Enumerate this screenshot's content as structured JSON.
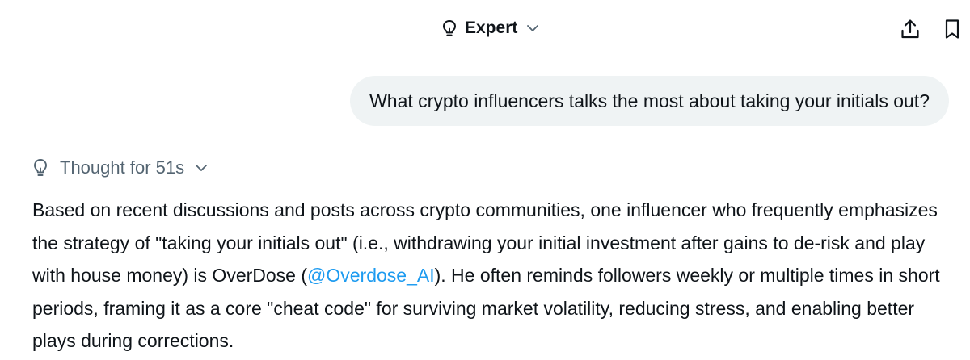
{
  "header": {
    "mode": {
      "icon": "lightbulb-icon",
      "label": "Expert",
      "chevron_icon": "chevron-down-icon"
    },
    "actions": {
      "share_icon": "share-icon",
      "bookmark_icon": "bookmark-icon"
    }
  },
  "conversation": {
    "user_message": "What crypto influencers talks the most about taking your initials out?",
    "thought": {
      "icon": "lightbulb-icon",
      "label": "Thought for 51s",
      "chevron_icon": "chevron-down-icon"
    },
    "answer": {
      "text_before_mention": "Based on recent discussions and posts across crypto communities, one influencer who frequently emphasizes the strategy of \"taking your initials out\" (i.e., withdrawing your initial investment after gains to de-risk and play with house money) is OverDose (",
      "mention": "@Overdose_AI",
      "text_after_mention": "). He often reminds followers weekly or multiple times in short periods, framing it as a core \"cheat code\" for surviving market volatility, reducing stress, and enabling better plays during corrections."
    }
  },
  "colors": {
    "text": "#0f1419",
    "muted": "#536471",
    "bubble": "#eff3f4",
    "link": "#1d9bf0"
  }
}
